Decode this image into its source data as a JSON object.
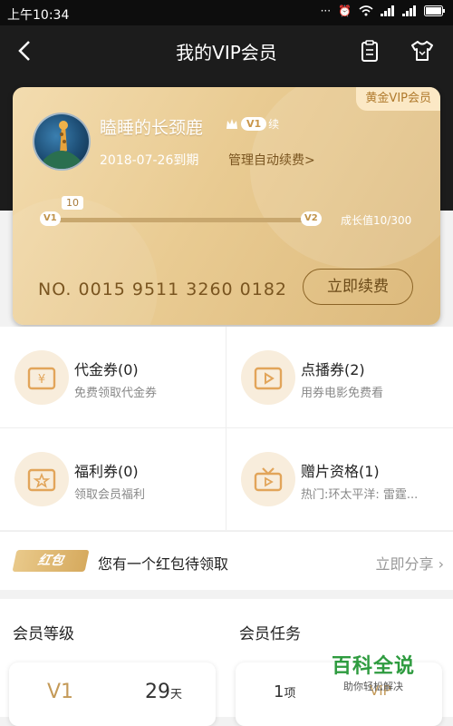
{
  "status_bar": {
    "time": "上午10:34"
  },
  "header": {
    "title": "我的VIP会员"
  },
  "vip_card": {
    "tier_badge": "黄金VIP会员",
    "username": "瞌睡的长颈鹿",
    "level": "V1",
    "renew_mark": "续",
    "expiry": "2018-07-26到期",
    "manage_auto_renew": "管理自动续费>",
    "progress": {
      "current": 10,
      "max": 300,
      "start_label": "V1",
      "end_label": "V2",
      "growth_text": "成长值10/300"
    },
    "card_number": "NO. 0015 9511 3260 0182",
    "renew_button": "立即续费"
  },
  "benefits": [
    {
      "title": "代金券(0)",
      "subtitle": "免费领取代金券",
      "icon": "yen-ticket-icon"
    },
    {
      "title": "点播券(2)",
      "subtitle": "用券电影免费看",
      "icon": "play-ticket-icon"
    },
    {
      "title": "福利券(0)",
      "subtitle": "领取会员福利",
      "icon": "star-ticket-icon"
    },
    {
      "title": "赠片资格(1)",
      "subtitle": "热门:环太平洋: 雷霆...",
      "icon": "gift-tv-icon"
    }
  ],
  "red_packet": {
    "tag": "红包",
    "text": "您有一个红包待领取",
    "share": "立即分享"
  },
  "member_level": {
    "title": "会员等级",
    "level": "V1",
    "days": "29",
    "days_unit": "天"
  },
  "member_tasks": {
    "title": "会员任务",
    "count": "1",
    "count_unit": "项",
    "extra": "VIP"
  },
  "watermark": {
    "main": "百科全说",
    "sub": "助你轻松解决"
  },
  "colors": {
    "gold": "#e9cb92",
    "dark": "#1c1c1c"
  }
}
